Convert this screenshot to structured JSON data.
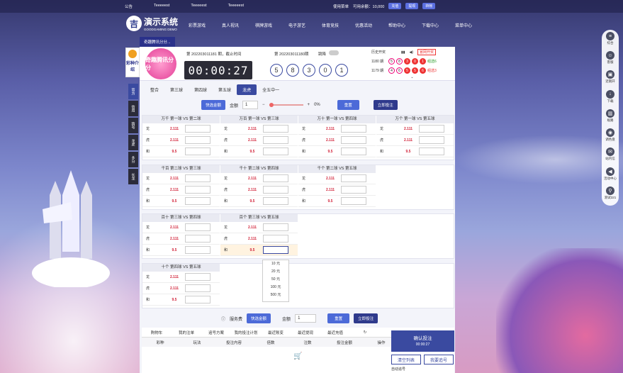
{
  "topbar": {
    "notice_label": "公告",
    "notice_items": [
      "Teeeeest",
      "Teeeeest",
      "Teeeeest"
    ],
    "user_label": "使用菜单",
    "balance_label": "可用余额：10,000",
    "deposit": "充值",
    "withdraw": "提现",
    "transfer": "转帐"
  },
  "logo": {
    "title": "演示系统",
    "subtitle": "GOODGAMING DEMO"
  },
  "nav": [
    "彩票游戏",
    "真人视讯",
    "棋牌游戏",
    "电子游艺",
    "体育竞技",
    "优惠活动",
    "帮助中心",
    "下载中心",
    "菜单中心"
  ],
  "subnav": "奇趣腾讯分分...",
  "game_intro": "彩种介绍",
  "header": {
    "game_name": "奇趣腾讯分分",
    "period_label": "第 202203011181 期，截止时间",
    "timer": "00:00:27",
    "last_label": "第 202203011180期",
    "numbers": [
      "5",
      "8",
      "3",
      "0",
      "1"
    ],
    "trend_label": "跳降",
    "history_label": "历史开奖",
    "official_label": "官网开奖",
    "history": [
      {
        "period": "1180 期",
        "balls": [
          "5",
          "8",
          "3",
          "0",
          "1"
        ],
        "result": "组选6"
      },
      {
        "period": "1179 期",
        "balls": [
          "4",
          "6",
          "5",
          "5",
          "6"
        ],
        "result": "组选3"
      }
    ]
  },
  "side_tabs": [
    "官方",
    "信用",
    "猜号",
    "龙虎",
    "多分",
    "长龙"
  ],
  "tabs": [
    "整合",
    "第三球",
    "第四球",
    "第五球",
    "龙虎",
    "全五中一"
  ],
  "controls": {
    "quick": "快选金额",
    "amount_label": "金额",
    "amount": "1",
    "percent": "0%",
    "reset": "重置",
    "submit": "立即投注"
  },
  "groups": [
    {
      "title": "万千 第一球 VS 第二球"
    },
    {
      "title": "万百 第一球 VS 第三球"
    },
    {
      "title": "万十 第一球 VS 第四球"
    },
    {
      "title": "万个 第一球 VS 第五球"
    },
    {
      "title": "千百 第二球 VS 第三球"
    },
    {
      "title": "千十 第二球 VS 第四球"
    },
    {
      "title": "千个 第二球 VS 第五球"
    },
    {
      "title": "百十 第三球 VS 第四球"
    },
    {
      "title": "百个 第三球 VS 第五球"
    },
    {
      "title": "十个 第四球 VS 第五球"
    }
  ],
  "bet_rows": [
    {
      "name": "龙",
      "odds": "2.111"
    },
    {
      "name": "虎",
      "odds": "2.111"
    },
    {
      "name": "和",
      "odds": "9.5"
    }
  ],
  "dropdown": [
    "10 元",
    "20 元",
    "50 元",
    "100 元",
    "500 元"
  ],
  "bottom_ctrl": {
    "fee": "服务费",
    "quick": "快选金额",
    "amount_label": "金额",
    "amount": "1",
    "reset": "重置",
    "submit": "立即投注"
  },
  "bottom_tabs": [
    "购物车",
    "我的注单",
    "追号方案",
    "我的投注计划",
    "最近账变",
    "最近提现",
    "最近充值"
  ],
  "bottom_headers": [
    "彩种",
    "玩法",
    "投注内容",
    "倍数",
    "注数",
    "投注金额",
    "操作"
  ],
  "right": {
    "confirm": "确认投注",
    "confirm_time": "00:00:27",
    "clear": "清空列表",
    "chase": "我要追号",
    "chase_link": "自动追号"
  },
  "float": [
    "综合",
    "客服",
    "近期开",
    "下载",
    "规路",
    "调色盘",
    "站内信",
    "活动中心",
    "测试321"
  ]
}
